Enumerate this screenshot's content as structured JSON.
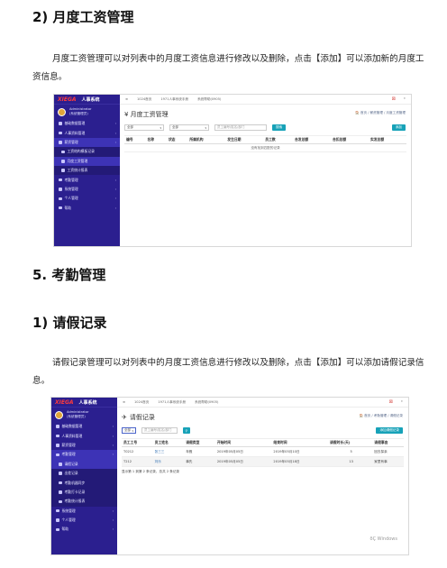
{
  "sec1": {
    "heading": "2)  月度工资管理",
    "para": "月度工资管理可以对列表中的月度工资信息进行修改以及删除，点击【添加】可以添加新的月度工资信息。"
  },
  "sec2": {
    "heading": "5.  考勤管理"
  },
  "sec3": {
    "heading": "1)  请假记录",
    "para": "请假记录管理可以对列表中的月度工资信息进行修改以及删除，点击【添加】可以添加请假记录信息。"
  },
  "app1": {
    "brand_logo": "XIEGA",
    "brand_sys": "人事系统",
    "user_name": "Administrator",
    "user_role": "(系统管理员)",
    "menu": [
      {
        "label": "基础数据管理",
        "arrow": "‹"
      },
      {
        "label": "人事资料管理",
        "arrow": "‹"
      },
      {
        "label": "薪资管理",
        "arrow": "‹"
      },
      {
        "label": "工资结构模板记录",
        "arrow": ""
      },
      {
        "label": "月度工资管理",
        "arrow": ""
      },
      {
        "label": "工资统计报表",
        "arrow": ""
      },
      {
        "label": "考勤管理",
        "arrow": "‹"
      },
      {
        "label": "系统管理",
        "arrow": "‹"
      },
      {
        "label": "个人管理",
        "arrow": "‹"
      },
      {
        "label": "帮助",
        "arrow": "‹"
      }
    ],
    "tabs": [
      "≡",
      "1024首页",
      "1971人事系统手册",
      "系统帮助(0905)"
    ],
    "page_title": "¥ 月度工资管理",
    "crumb": "🏠 首页 / 薪资管理 / 月度工资管理",
    "filter1": "全部",
    "filter2": "全部",
    "search_placeholder": "员工编号/姓名/部门",
    "search_btn": "搜索",
    "add_btn": "添加",
    "columns": [
      "编号",
      "名称",
      "状态",
      "所属机构",
      "发生日期",
      "员工数",
      "合发总额",
      "合扣总额",
      "实发总额"
    ],
    "empty": "没有找到匹配的记录"
  },
  "app2": {
    "brand_logo": "XIEGA",
    "brand_sys": "人事系统",
    "user_name": "Administrator",
    "user_role": "(系统管理员)",
    "menu": [
      {
        "label": "基础数据管理",
        "arrow": "‹"
      },
      {
        "label": "人事资料管理",
        "arrow": "‹"
      },
      {
        "label": "薪资管理",
        "arrow": "‹"
      },
      {
        "label": "考勤管理",
        "arrow": "‹"
      },
      {
        "label": "请假记录",
        "arrow": ""
      },
      {
        "label": "出差记录",
        "arrow": ""
      },
      {
        "label": "考勤机器同步",
        "arrow": ""
      },
      {
        "label": "考勤打卡记录",
        "arrow": ""
      },
      {
        "label": "考勤统计报表",
        "arrow": ""
      },
      {
        "label": "系统管理",
        "arrow": "‹"
      },
      {
        "label": "个人管理",
        "arrow": "‹"
      },
      {
        "label": "帮助",
        "arrow": "‹"
      }
    ],
    "tabs": [
      "≡",
      "1024首页",
      "1971人事系统手册",
      "系统帮助(0905)"
    ],
    "page_title": "请假记录",
    "crumb": "🏠 首页 / 考勤管理 / 请假记录",
    "filter1": "全部",
    "search_placeholder": "员工编号/姓名/部门",
    "add_btn": "添加请假记录",
    "columns": [
      "员工工号",
      "员工姓名",
      "请假类型",
      "开始时间",
      "结束时间",
      "请假时长(天)",
      "请假事由"
    ],
    "rows": [
      [
        "T0212",
        "张三三",
        "年假",
        "2019年05月05日",
        "2019年05月10日",
        "5",
        "回去探亲"
      ],
      [
        "T212",
        "刘乐",
        "事先",
        "2019年05月05日",
        "2019年05月18日",
        "13",
        "家里有事"
      ]
    ],
    "footer": "显示第 1 到第 2 条记录，总共 2 条记录",
    "watermark": "ðÇ Windows"
  }
}
